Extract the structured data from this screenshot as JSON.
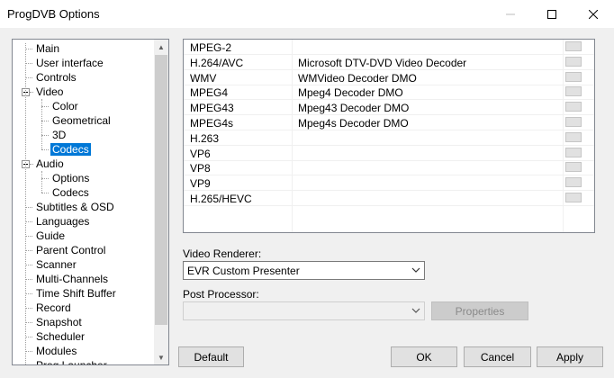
{
  "window": {
    "title": "ProgDVB Options"
  },
  "tree": {
    "items": [
      {
        "label": "Main",
        "level": 0
      },
      {
        "label": "User interface",
        "level": 0
      },
      {
        "label": "Controls",
        "level": 0
      },
      {
        "label": "Video",
        "level": 0,
        "expanded": true
      },
      {
        "label": "Color",
        "level": 1
      },
      {
        "label": "Geometrical",
        "level": 1
      },
      {
        "label": "3D",
        "level": 1
      },
      {
        "label": "Codecs",
        "level": 1,
        "selected": true
      },
      {
        "label": "Audio",
        "level": 0,
        "expanded": true
      },
      {
        "label": "Options",
        "level": 1
      },
      {
        "label": "Codecs",
        "level": 1
      },
      {
        "label": "Subtitles & OSD",
        "level": 0
      },
      {
        "label": "Languages",
        "level": 0
      },
      {
        "label": "Guide",
        "level": 0
      },
      {
        "label": "Parent Control",
        "level": 0
      },
      {
        "label": "Scanner",
        "level": 0
      },
      {
        "label": "Multi-Channels",
        "level": 0
      },
      {
        "label": "Time Shift Buffer",
        "level": 0
      },
      {
        "label": "Record",
        "level": 0
      },
      {
        "label": "Snapshot",
        "level": 0
      },
      {
        "label": "Scheduler",
        "level": 0
      },
      {
        "label": "Modules",
        "level": 0
      },
      {
        "label": "Prog Launcher",
        "level": 0
      }
    ]
  },
  "codecs": {
    "rows": [
      {
        "format": "MPEG-2",
        "decoder": ""
      },
      {
        "format": "H.264/AVC",
        "decoder": "Microsoft DTV-DVD Video Decoder"
      },
      {
        "format": "WMV",
        "decoder": "WMVideo Decoder DMO"
      },
      {
        "format": "MPEG4",
        "decoder": "Mpeg4 Decoder DMO"
      },
      {
        "format": "MPEG43",
        "decoder": "Mpeg43 Decoder DMO"
      },
      {
        "format": "MPEG4s",
        "decoder": "Mpeg4s Decoder DMO"
      },
      {
        "format": "H.263",
        "decoder": ""
      },
      {
        "format": "VP6",
        "decoder": ""
      },
      {
        "format": "VP8",
        "decoder": ""
      },
      {
        "format": "VP9",
        "decoder": ""
      },
      {
        "format": "H.265/HEVC",
        "decoder": ""
      }
    ]
  },
  "video_renderer": {
    "label": "Video Renderer:",
    "value": "EVR Custom Presenter"
  },
  "post_processor": {
    "label": "Post Processor:",
    "value": "",
    "properties_label": "Properties"
  },
  "buttons": {
    "default": "Default",
    "ok": "OK",
    "cancel": "Cancel",
    "apply": "Apply"
  },
  "colors": {
    "selection": "#0078d7",
    "face": "#f0f0f0"
  }
}
